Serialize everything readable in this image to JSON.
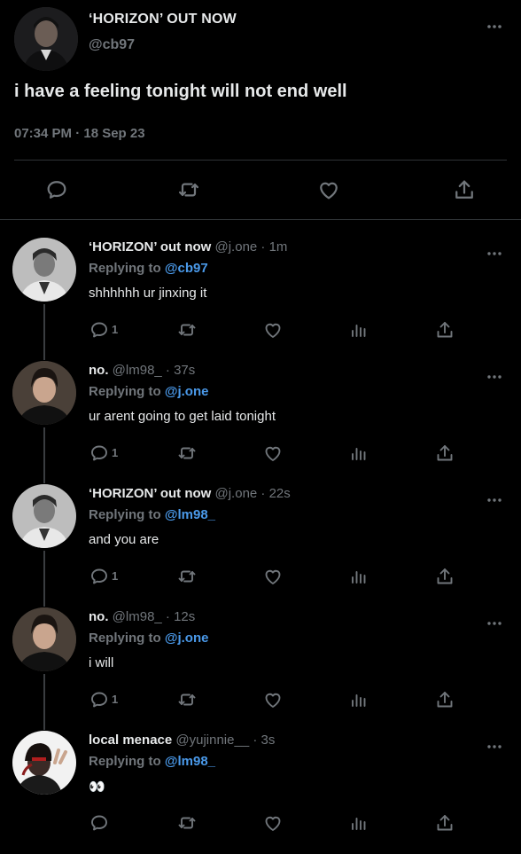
{
  "main_tweet": {
    "author_name": "‘HORIZON’ OUT NOW",
    "author_handle": "@cb97",
    "text": "i have a feeling tonight will not end well",
    "timestamp": "07:34 PM · 18 Sep 23"
  },
  "replies": [
    {
      "author_name": "‘HORIZON’ out now",
      "handle_time": "@j.one · 1m",
      "replying_prefix": "Replying to",
      "replying_to": "@cb97",
      "text": "shhhhhh ur jinxing it",
      "reply_count": "1"
    },
    {
      "author_name": "no.",
      "handle_time": "@lm98_ · 37s",
      "replying_prefix": "Replying to",
      "replying_to": "@j.one",
      "text": "ur arent going to get laid tonight",
      "reply_count": "1"
    },
    {
      "author_name": "‘HORIZON’ out now",
      "handle_time": "@j.one · 22s",
      "replying_prefix": "Replying to",
      "replying_to": "@lm98_",
      "text": "and you are",
      "reply_count": "1"
    },
    {
      "author_name": "no.",
      "handle_time": "@lm98_ · 12s",
      "replying_prefix": "Replying to",
      "replying_to": "@j.one",
      "text": "i will",
      "reply_count": "1"
    },
    {
      "author_name": "local menace",
      "handle_time": "@yujinnie__ · 3s",
      "replying_prefix": "Replying to",
      "replying_to": "@lm98_",
      "text": "👀",
      "reply_count": ""
    }
  ],
  "colors": {
    "background": "#000000",
    "text": "#e7e9ea",
    "muted": "#71767b",
    "mention": "#4a99e9",
    "divider": "#2f3336"
  },
  "icons": {
    "reply": "speech-bubble-icon",
    "retweet": "retweet-arrows-icon",
    "like": "heart-icon",
    "views": "bar-chart-icon",
    "share": "share-upload-icon",
    "more": "more-dots-icon"
  }
}
